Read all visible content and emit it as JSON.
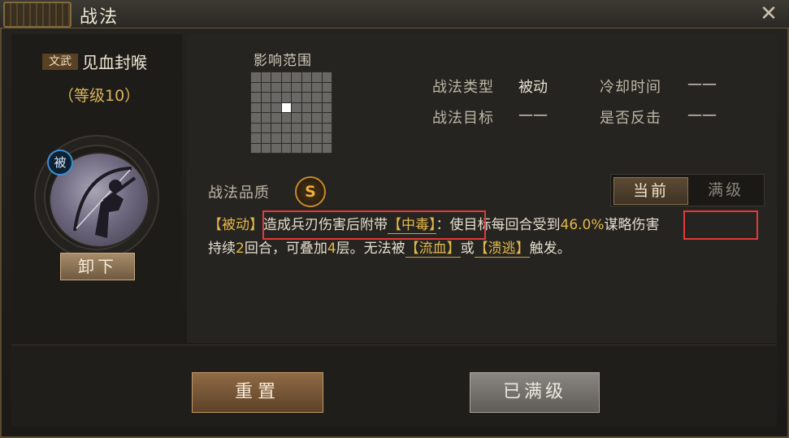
{
  "window": {
    "title": "战法",
    "close_icon": "close-icon"
  },
  "skill": {
    "type_tag": "文武",
    "name": "见血封喉",
    "level_text": "（等级10）",
    "passive_badge": "被",
    "unequip_label": "卸下"
  },
  "range": {
    "label": "影响范围",
    "grid_size": 8,
    "active_cell": {
      "row": 3,
      "col": 3
    }
  },
  "info": {
    "type_label": "战法类型",
    "type_value": "被动",
    "cooldown_label": "冷却时间",
    "cooldown_value": "——",
    "target_label": "战法目标",
    "target_value": "——",
    "counter_label": "是否反击",
    "counter_value": "——"
  },
  "quality": {
    "label": "战法品质",
    "grade": "S"
  },
  "tabs": {
    "current": "当前",
    "max": "满级"
  },
  "description": {
    "p1": "【被动】",
    "p2": "造成兵刃伤害后附带",
    "p3": "【中毒】",
    "p4": "：使目标每回合受到",
    "p5": "46.0%",
    "p6": "谋略伤害",
    "p7": "持续",
    "p8": "2",
    "p9": "回合，可叠加",
    "p10": "4",
    "p11": "层。无法被",
    "p12": "【流血】",
    "p13": "或",
    "p14": "【溃逃】",
    "p15": "触发。"
  },
  "buttons": {
    "reset": "重置",
    "maxed": "已满级"
  },
  "colors": {
    "highlight": "#e23a3a",
    "keyword": "#e3b84a",
    "passive_badge": "#3d8fd1",
    "quality": "#f0b13c"
  }
}
